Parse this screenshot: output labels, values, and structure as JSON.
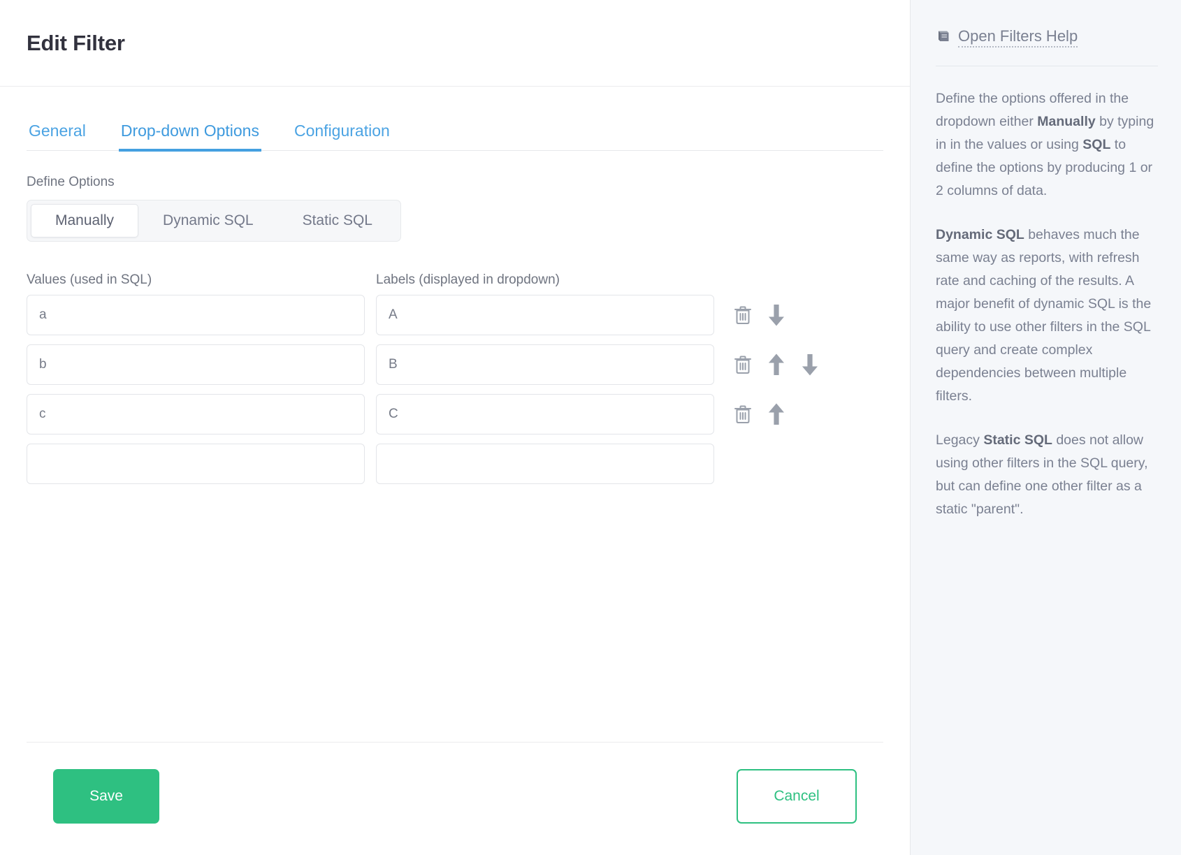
{
  "header": {
    "title": "Edit Filter"
  },
  "tabs": [
    {
      "label": "General",
      "active": false
    },
    {
      "label": "Drop-down Options",
      "active": true
    },
    {
      "label": "Configuration",
      "active": false
    }
  ],
  "define_options": {
    "label": "Define Options",
    "modes": [
      {
        "label": "Manually",
        "selected": true
      },
      {
        "label": "Dynamic SQL",
        "selected": false
      },
      {
        "label": "Static SQL",
        "selected": false
      }
    ]
  },
  "options_table": {
    "headers": {
      "values": "Values (used in SQL)",
      "labels": "Labels (displayed in dropdown)"
    },
    "placeholder": "",
    "rows": [
      {
        "value": "a",
        "label": "A",
        "can_delete": true,
        "can_move_up": false,
        "can_move_down": true
      },
      {
        "value": "b",
        "label": "B",
        "can_delete": true,
        "can_move_up": true,
        "can_move_down": true
      },
      {
        "value": "c",
        "label": "C",
        "can_delete": true,
        "can_move_up": true,
        "can_move_down": false
      },
      {
        "value": "",
        "label": "",
        "can_delete": false,
        "can_move_up": false,
        "can_move_down": false
      }
    ]
  },
  "footer": {
    "save_label": "Save",
    "cancel_label": "Cancel"
  },
  "help": {
    "link_label": "Open Filters Help",
    "icon": "book-icon",
    "paragraphs": [
      {
        "parts": [
          {
            "text": "Define the options offered in the dropdown either ",
            "bold": false
          },
          {
            "text": "Manually",
            "bold": true
          },
          {
            "text": " by typing in in the values or using ",
            "bold": false
          },
          {
            "text": "SQL",
            "bold": true
          },
          {
            "text": " to define the options by producing 1 or 2 columns of data.",
            "bold": false
          }
        ]
      },
      {
        "parts": [
          {
            "text": "Dynamic SQL",
            "bold": true
          },
          {
            "text": " behaves much the same way as reports, with refresh rate and caching of the results. A major benefit of dynamic SQL is the ability to use other filters in the SQL query and create complex dependencies between multiple filters.",
            "bold": false
          }
        ]
      },
      {
        "parts": [
          {
            "text": "Legacy ",
            "bold": false
          },
          {
            "text": "Static SQL",
            "bold": true
          },
          {
            "text": " does not allow using other filters in the SQL query, but can define one other filter as a static \"parent\".",
            "bold": false
          }
        ]
      }
    ]
  },
  "colors": {
    "accent_blue": "#44a0e0",
    "save_green": "#2ec081",
    "title_dark": "#32323e",
    "muted_text": "#7a8091",
    "help_bg": "#f5f7fa"
  }
}
